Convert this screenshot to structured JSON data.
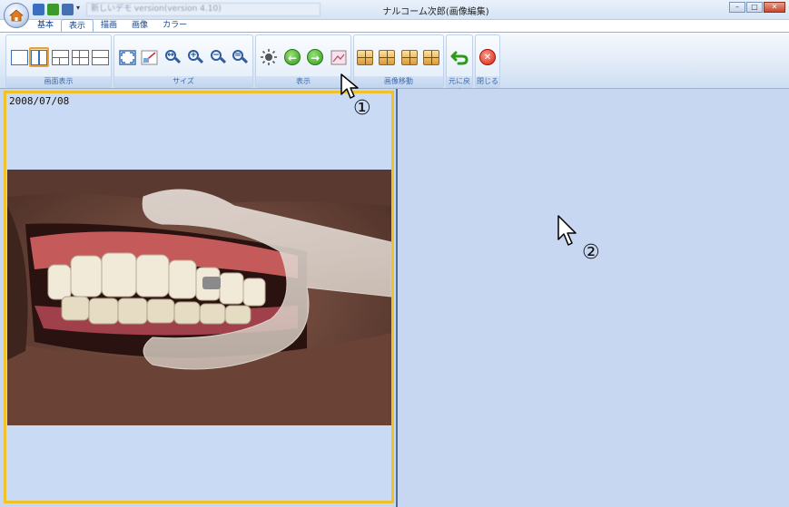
{
  "window": {
    "title": "ナルコーム次郎(画像編集)",
    "document_field": "新しいデモ version(version 4.10)",
    "controls": [
      "–",
      "□",
      "✕"
    ]
  },
  "tabs": [
    {
      "label": "基本"
    },
    {
      "label": "表示"
    },
    {
      "label": "描画"
    },
    {
      "label": "画像"
    },
    {
      "label": "カラー"
    }
  ],
  "ribbon": {
    "groups": [
      {
        "label": "画面表示"
      },
      {
        "label": "サイズ"
      },
      {
        "label": "表示"
      },
      {
        "label": "画像移動"
      },
      {
        "label": "元に戻す"
      },
      {
        "label": "閉じる"
      }
    ]
  },
  "viewer": {
    "left_panel_date": "2008/07/08",
    "left_panel_selected": true
  },
  "annotations": {
    "marker_1": "①",
    "marker_2": "②"
  },
  "colors": {
    "selection_border": "#f0c22a",
    "panel_background": "#c9daf5",
    "divider": "#4d6d95"
  }
}
